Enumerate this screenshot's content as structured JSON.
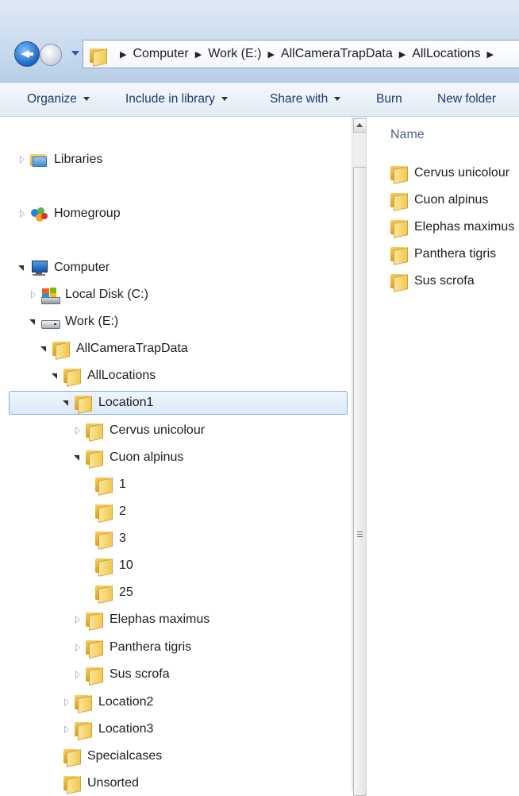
{
  "address_bar": {
    "breadcrumbs": [
      "Computer",
      "Work (E:)",
      "AllCameraTrapData",
      "AllLocations"
    ],
    "icons": [
      "back-arrow-icon",
      "forward-arrow-icon",
      "history-dropdown-icon",
      "folder-icon",
      "breadcrumb-separator-icon"
    ]
  },
  "toolbar": {
    "organize": "Organize",
    "include_in_library": "Include in library",
    "share_with": "Share with",
    "burn": "Burn",
    "new_folder": "New folder"
  },
  "nav_tree": {
    "libraries": "Libraries",
    "homegroup": "Homegroup",
    "computer": "Computer",
    "local_disk": "Local Disk (C:)",
    "work_drive": "Work (E:)",
    "allcameratrapdata": "AllCameraTrapData",
    "alllocations": "AllLocations",
    "location1": "Location1",
    "cervus_unicolour": "Cervus unicolour",
    "cuon_alpinus": "Cuon alpinus",
    "sub_1": "1",
    "sub_2": "2",
    "sub_3": "3",
    "sub_10": "10",
    "sub_25": "25",
    "elephas_maximus": "Elephas maximus",
    "panthera_tigris": "Panthera tigris",
    "sus_scrofa": "Sus scrofa",
    "location2": "Location2",
    "location3": "Location3",
    "specialcases": "Specialcases",
    "unsorted": "Unsorted"
  },
  "content": {
    "column_name": "Name",
    "items": [
      "Cervus unicolour",
      "Cuon alpinus",
      "Elephas maximus",
      "Panthera tigris",
      "Sus scrofa"
    ]
  },
  "colors": {
    "selection_border": "#84acdd",
    "folder_yellow": "#f2c84e",
    "toolbar_text": "#1f3a6a"
  }
}
